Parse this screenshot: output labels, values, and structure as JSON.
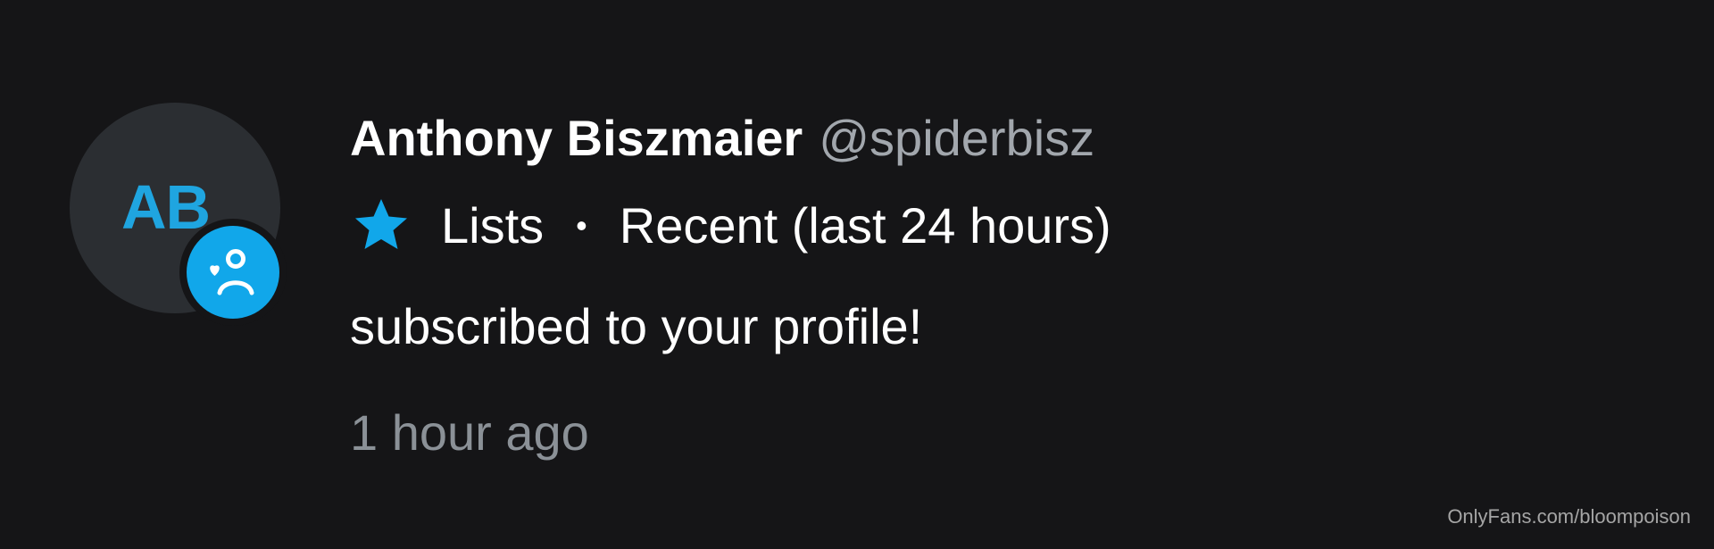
{
  "notification": {
    "avatar_initials": "AB",
    "name": "Anthony Biszmaier",
    "handle": "@spiderbisz",
    "list_label": "Lists",
    "separator": "•",
    "list_detail": "Recent (last 24 hours)",
    "message": "subscribed to your profile!",
    "time": "1 hour ago"
  },
  "watermark": "OnlyFans.com/bloompoison",
  "icons": {
    "badge": "subscriber-heart-person-icon",
    "star": "star-icon"
  },
  "colors": {
    "background": "#151517",
    "accent": "#11a7ea",
    "avatar_background": "#2b2e32",
    "secondary_text": "#a2a7ad"
  }
}
